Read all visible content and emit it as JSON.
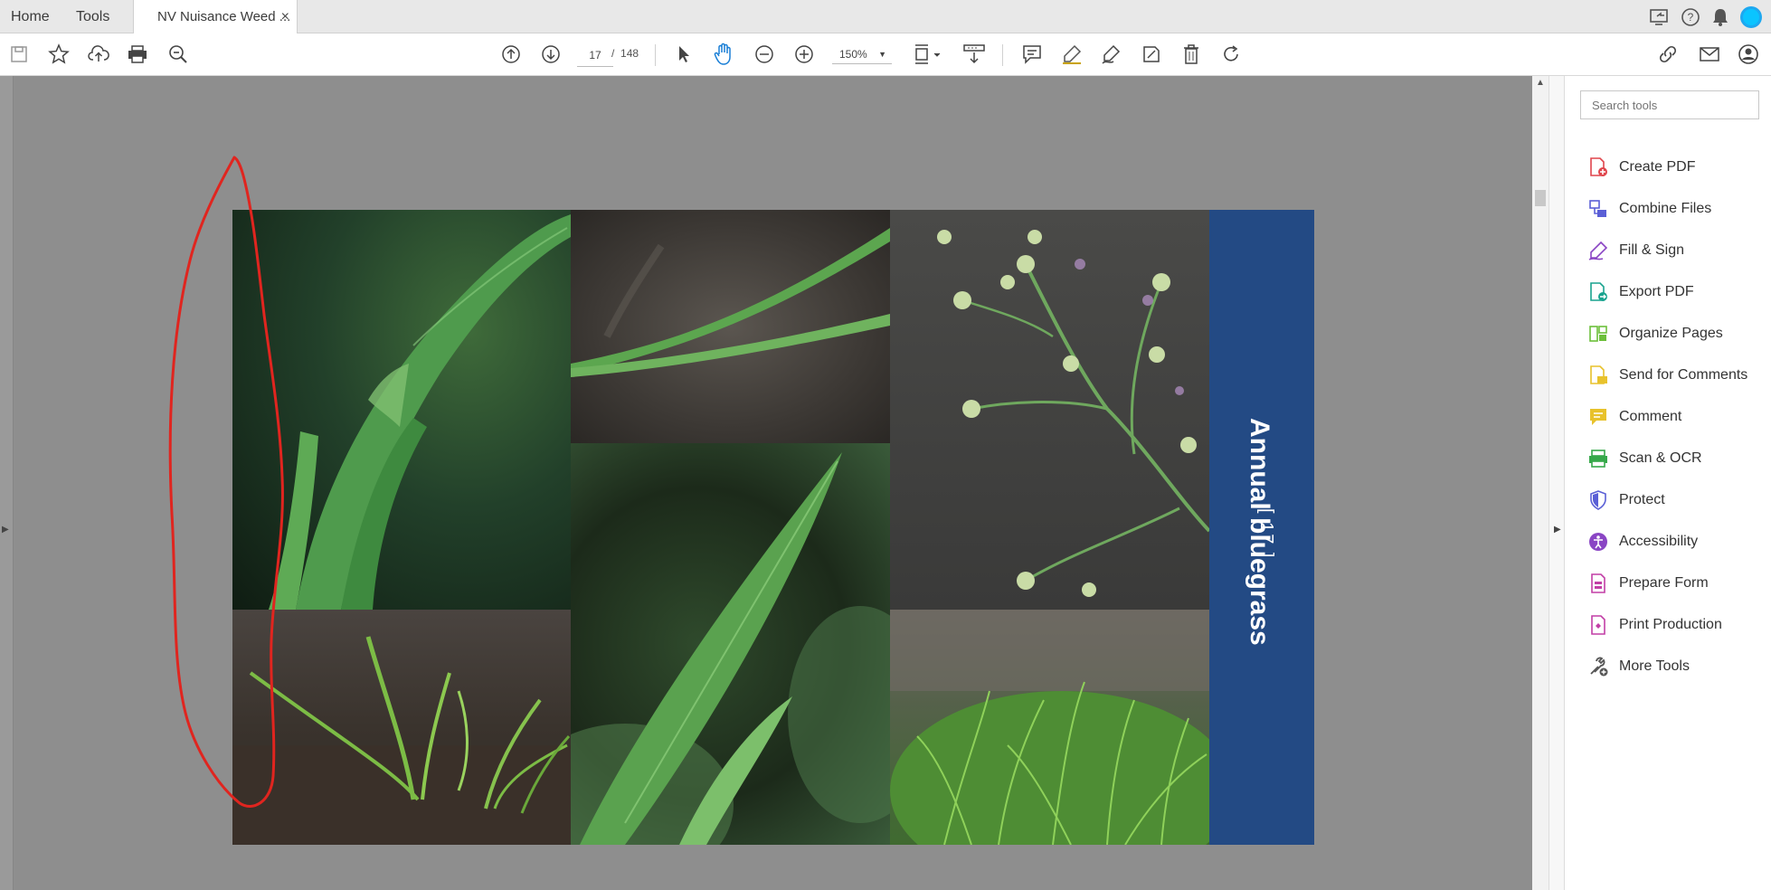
{
  "tabs": {
    "home": "Home",
    "tools": "Tools",
    "document": "NV Nuisance Weed ...",
    "close": "×"
  },
  "toolbar": {
    "current_page": "17",
    "page_separator": "/",
    "page_total": "148",
    "zoom": "150%"
  },
  "document": {
    "species_title": "Annual bluegrass",
    "page_label": "[ 17 ]",
    "band_color": "#234a84"
  },
  "tools_pane": {
    "search_placeholder": "Search tools",
    "items": [
      {
        "label": "Create PDF",
        "icon": "create-pdf-icon",
        "color": "#e0454c"
      },
      {
        "label": "Combine Files",
        "icon": "combine-files-icon",
        "color": "#5a5fd6"
      },
      {
        "label": "Fill & Sign",
        "icon": "fill-sign-icon",
        "color": "#8a45c4"
      },
      {
        "label": "Export PDF",
        "icon": "export-pdf-icon",
        "color": "#1aa38f"
      },
      {
        "label": "Organize Pages",
        "icon": "organize-pages-icon",
        "color": "#6cbf3a"
      },
      {
        "label": "Send for Comments",
        "icon": "send-for-comments-icon",
        "color": "#e8c22c"
      },
      {
        "label": "Comment",
        "icon": "comment-icon",
        "color": "#e8c22c"
      },
      {
        "label": "Scan & OCR",
        "icon": "scan-ocr-icon",
        "color": "#36a84a"
      },
      {
        "label": "Protect",
        "icon": "protect-icon",
        "color": "#5a5fd6"
      },
      {
        "label": "Accessibility",
        "icon": "accessibility-icon",
        "color": "#8a45c4"
      },
      {
        "label": "Prepare Form",
        "icon": "prepare-form-icon",
        "color": "#c23fa6"
      },
      {
        "label": "Print Production",
        "icon": "print-production-icon",
        "color": "#c23fa6"
      },
      {
        "label": "More Tools",
        "icon": "more-tools-icon",
        "color": "#555555"
      }
    ]
  },
  "annotation": {
    "color": "#e0251f"
  }
}
